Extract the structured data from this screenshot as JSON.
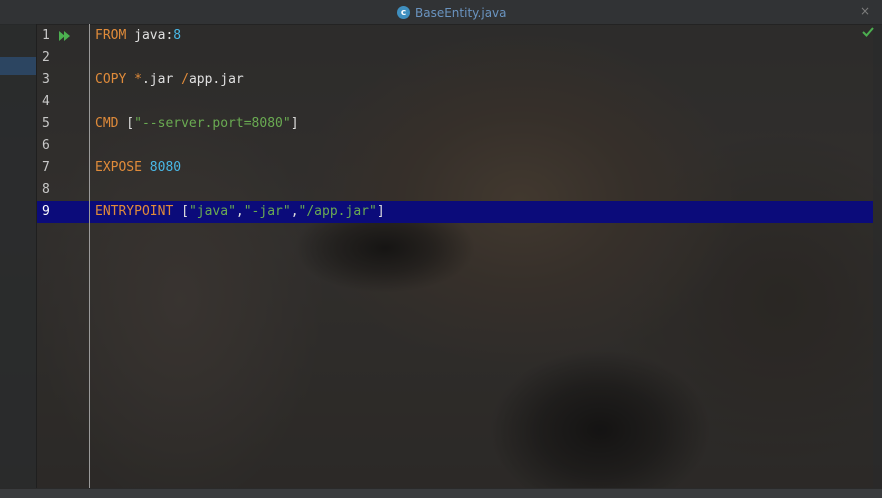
{
  "tab": {
    "title": "BaseEntity.java",
    "icon_letter": "c"
  },
  "window": {
    "close_glyph": "×"
  },
  "editor": {
    "current_line": 9,
    "lines": [
      {
        "num": "1",
        "tokens": [
          {
            "t": "FROM",
            "c": "kw"
          },
          {
            "t": " java:",
            "c": "plain"
          },
          {
            "t": "8",
            "c": "num"
          }
        ]
      },
      {
        "num": "2",
        "tokens": []
      },
      {
        "num": "3",
        "tokens": [
          {
            "t": "COPY",
            "c": "kw"
          },
          {
            "t": " ",
            "c": "plain"
          },
          {
            "t": "*",
            "c": "kw"
          },
          {
            "t": ".jar ",
            "c": "plain"
          },
          {
            "t": "/",
            "c": "kw"
          },
          {
            "t": "app.jar",
            "c": "plain"
          }
        ]
      },
      {
        "num": "4",
        "tokens": []
      },
      {
        "num": "5",
        "tokens": [
          {
            "t": "CMD",
            "c": "kw"
          },
          {
            "t": " [",
            "c": "plain"
          },
          {
            "t": "\"--server.port=8080\"",
            "c": "str"
          },
          {
            "t": "]",
            "c": "plain"
          }
        ]
      },
      {
        "num": "6",
        "tokens": []
      },
      {
        "num": "7",
        "tokens": [
          {
            "t": "EXPOSE",
            "c": "kw"
          },
          {
            "t": " ",
            "c": "plain"
          },
          {
            "t": "8080",
            "c": "num"
          }
        ]
      },
      {
        "num": "8",
        "tokens": []
      },
      {
        "num": "9",
        "tokens": [
          {
            "t": "ENTRYPOINT",
            "c": "kw"
          },
          {
            "t": " [",
            "c": "plain"
          },
          {
            "t": "\"java\"",
            "c": "str"
          },
          {
            "t": ",",
            "c": "plain"
          },
          {
            "t": "\"-jar\"",
            "c": "str"
          },
          {
            "t": ",",
            "c": "plain"
          },
          {
            "t": "\"/app.jar\"",
            "c": "str"
          },
          {
            "t": "]",
            "c": "plain"
          }
        ]
      }
    ]
  },
  "icons": {
    "run": "run-gutter-icon",
    "inspection": "check-icon",
    "close": "close-icon",
    "file_type": "class-icon"
  },
  "colors": {
    "keyword": "#e08b3a",
    "number": "#49b8e6",
    "string": "#6aab52",
    "current_line": "#0b0b7a",
    "check": "#4caf50"
  }
}
